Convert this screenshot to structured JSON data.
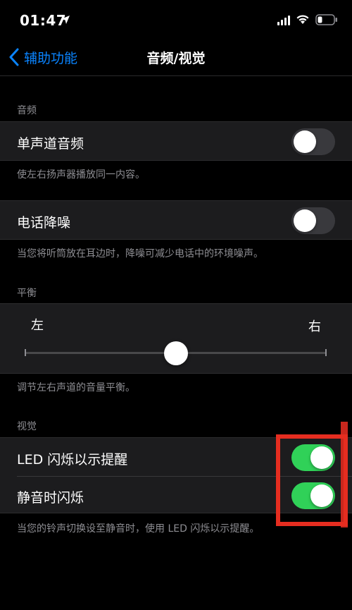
{
  "status_bar": {
    "time": "01:47",
    "icons": [
      "location-arrow-icon",
      "signal-icon",
      "wifi-icon",
      "battery-icon"
    ]
  },
  "nav": {
    "back_label": "辅助功能",
    "title": "音频/视觉"
  },
  "audio_section": {
    "header": "音频",
    "mono_audio": {
      "label": "单声道音频",
      "enabled": false
    },
    "mono_audio_footer": "使左右扬声器播放同一内容。",
    "noise_cancel": {
      "label": "电话降噪",
      "enabled": false
    },
    "noise_cancel_footer": "当您将听筒放在耳边时，降噪可减少电话中的环境噪声。"
  },
  "balance_section": {
    "header": "平衡",
    "left_label": "左",
    "right_label": "右",
    "balance_value": 0.5,
    "footer": "调节左右声道的音量平衡。"
  },
  "visual_section": {
    "header": "视觉",
    "led_flash": {
      "label": "LED 闪烁以示提醒",
      "enabled": true
    },
    "flash_silent": {
      "label": "静音时闪烁",
      "enabled": true
    },
    "footer": "当您的铃声切换设至静音时，使用 LED 闪烁以示提醒。"
  },
  "colors": {
    "background": "#000000",
    "cell": "#1c1c1e",
    "accent": "#0a84ff",
    "toggle_on": "#30d158",
    "toggle_off": "#39393d",
    "secondary_text": "#8e8e93",
    "highlight": "#e52d20"
  }
}
